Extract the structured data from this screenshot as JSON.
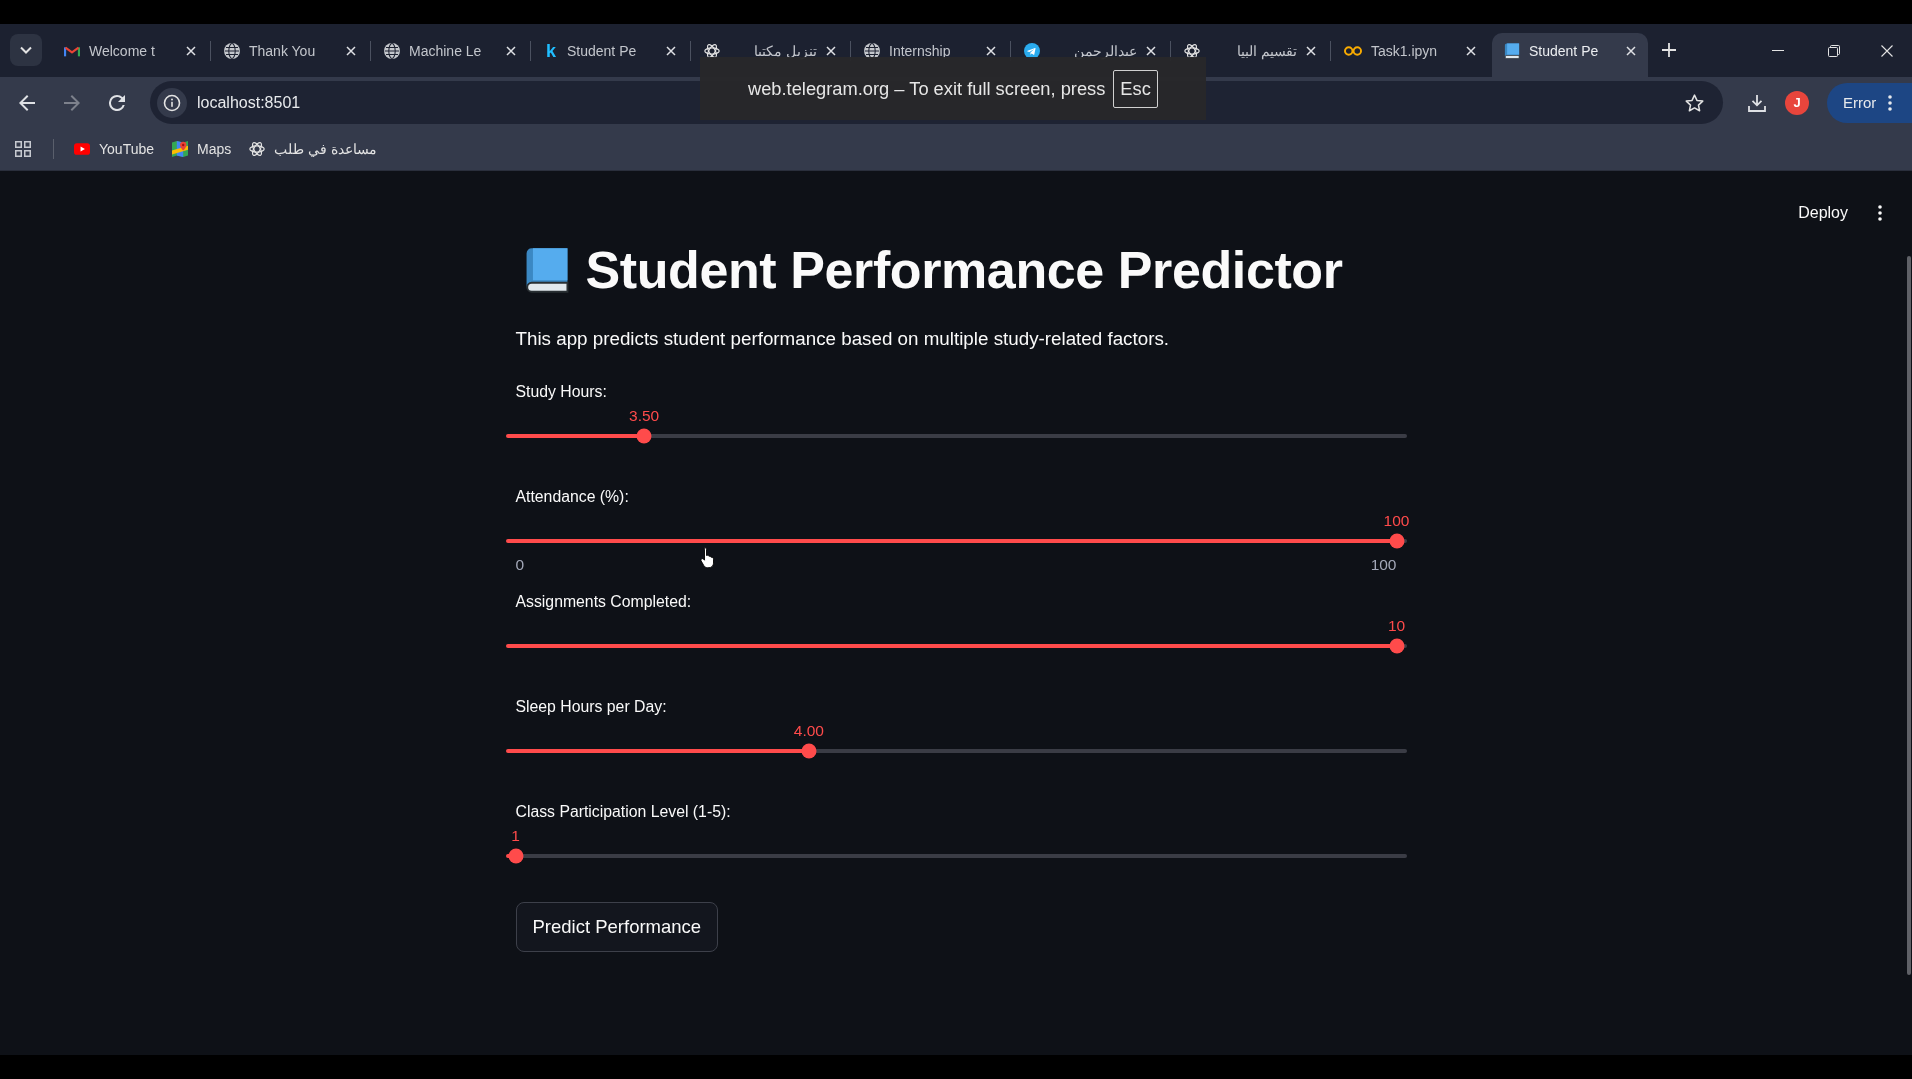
{
  "browser": {
    "tabs": [
      {
        "title": "Welcome t",
        "kind": "mail",
        "selected": false
      },
      {
        "title": "Thank You",
        "kind": "globe",
        "selected": false
      },
      {
        "title": "Machine Le",
        "kind": "globe",
        "selected": false
      },
      {
        "title": "Student Pe",
        "kind": "letter",
        "icon_text": "k",
        "selected": false
      },
      {
        "title": "تنزيل مكتبا",
        "kind": "knot",
        "selected": false
      },
      {
        "title": "Internship",
        "kind": "globe",
        "selected": false
      },
      {
        "title": "عبدالرحمن",
        "kind": "plane",
        "selected": false
      },
      {
        "title": "تقسيم البيا",
        "kind": "knot",
        "selected": false
      },
      {
        "title": "Task1.ipyn",
        "kind": "rings",
        "selected": false
      },
      {
        "title": "Student Pe",
        "kind": "book",
        "selected": true
      }
    ],
    "back_button": {
      "disabled": false
    },
    "forward_button": {
      "disabled": true
    },
    "address": {
      "url": "localhost:8501"
    },
    "profile": {
      "initial": "J"
    },
    "status_button": {
      "label": "Error"
    },
    "fullscreen_notice": {
      "text": "web.telegram.org – To exit full screen, press",
      "key": "Esc"
    },
    "bookmarks": [
      {
        "label": "YouTube",
        "kind": "play"
      },
      {
        "label": "Maps",
        "kind": "pin"
      },
      {
        "label": "مساعدة في طلب",
        "kind": "knot"
      }
    ]
  },
  "app": {
    "deploy": "Deploy",
    "title": "Student Performance Predictor",
    "description": "This app predicts student performance based on multiple study-related factors.",
    "sliders": [
      {
        "label": "Study Hours:",
        "value": "3.50",
        "level": 0.146
      },
      {
        "label": "Attendance (%):",
        "value": "100",
        "level": 1,
        "min_label": "0",
        "max_label": "100"
      },
      {
        "label": "Assignments Completed:",
        "value": "10",
        "level": 1
      },
      {
        "label": "Sleep Hours per Day:",
        "value": "4.00",
        "level": 0.333
      },
      {
        "label": "Class Participation Level (1-5):",
        "value": "1",
        "level": 0
      }
    ],
    "button": "Predict Performance"
  }
}
